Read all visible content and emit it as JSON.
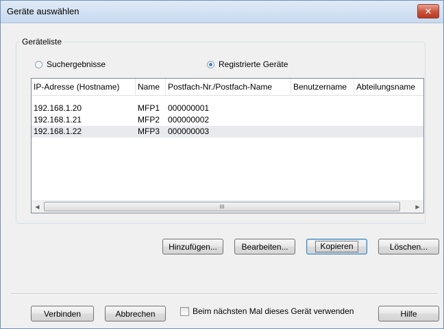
{
  "window": {
    "title": "Geräte auswählen",
    "close_glyph": "✕"
  },
  "group": {
    "label": "Geräteliste"
  },
  "radios": [
    {
      "label": "Suchergebnisse",
      "checked": false
    },
    {
      "label": "Registrierte Geräte",
      "checked": true
    }
  ],
  "table": {
    "columns": [
      "IP-Adresse (Hostname)",
      "Name",
      "Postfach-Nr./Postfach-Name",
      "Benutzername",
      "Abteilungsname"
    ],
    "rows": [
      [
        "192.168.1.20",
        "MFP1",
        "000000001",
        "",
        ""
      ],
      [
        "192.168.1.21",
        "MFP2",
        "000000002",
        "",
        ""
      ],
      [
        "192.168.1.22",
        "MFP3",
        "000000003",
        "",
        ""
      ]
    ],
    "selected_row": 2
  },
  "scrollbar": {
    "left_arrow": "◀",
    "right_arrow": "▶",
    "grip": "III"
  },
  "actions": {
    "add": "Hinzufügen...",
    "edit": "Bearbeiten...",
    "copy": "Kopieren",
    "delete": "Löschen..."
  },
  "footer": {
    "connect": "Verbinden",
    "cancel": "Abbrechen",
    "remember": "Beim nächsten Mal dieses Gerät verwenden",
    "help": "Hilfe"
  }
}
